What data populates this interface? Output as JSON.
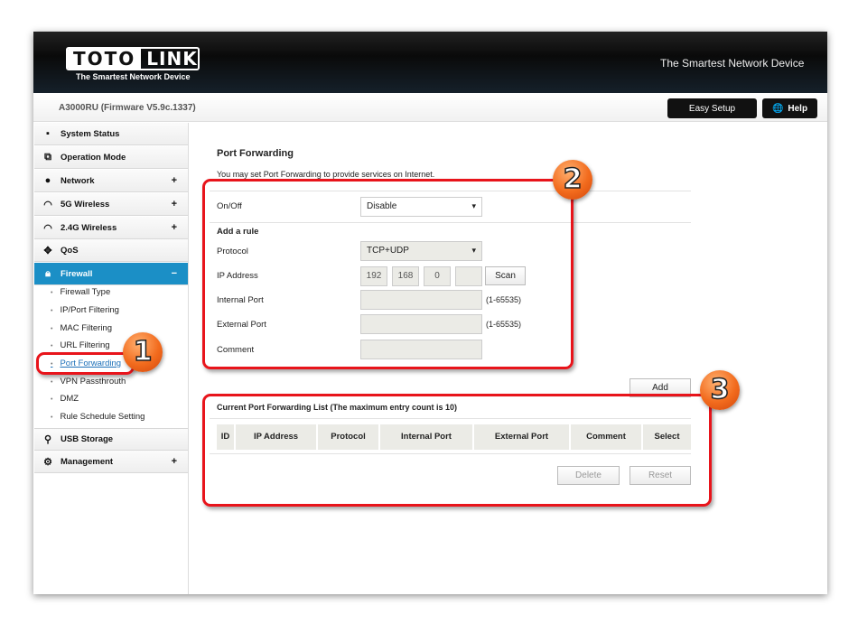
{
  "header": {
    "logo_left": "TOTO",
    "logo_right": "LINK",
    "logo_tagline": "The Smartest Network Device",
    "tagline": "The Smartest Network Device",
    "firmware": "A3000RU (Firmware V5.9c.1337)",
    "easy_setup": "Easy Setup",
    "help": "Help"
  },
  "sidebar": {
    "items": [
      {
        "label": "System Status",
        "icon": "chat-icon",
        "expand": ""
      },
      {
        "label": "Operation Mode",
        "icon": "windows-icon",
        "expand": ""
      },
      {
        "label": "Network",
        "icon": "globe-icon",
        "expand": "+"
      },
      {
        "label": "5G Wireless",
        "icon": "wifi-icon",
        "expand": "+"
      },
      {
        "label": "2.4G Wireless",
        "icon": "wifi-icon",
        "expand": "+"
      },
      {
        "label": "QoS",
        "icon": "arrows-icon",
        "expand": ""
      },
      {
        "label": "Firewall",
        "icon": "lock-icon",
        "expand": "−"
      },
      {
        "label": "USB Storage",
        "icon": "usb-icon",
        "expand": ""
      },
      {
        "label": "Management",
        "icon": "gear-icon",
        "expand": "+"
      }
    ],
    "firewall_sub": [
      "Firewall Type",
      "IP/Port Filtering",
      "MAC Filtering",
      "URL Filtering",
      "Port Forwarding",
      "VPN Passthrouth",
      "DMZ",
      "Rule Schedule Setting"
    ]
  },
  "main": {
    "title": "Port Forwarding",
    "description": "You may set Port Forwarding to provide services on Internet.",
    "onoff_label": "On/Off",
    "onoff_value": "Disable",
    "add_rule": "Add a rule",
    "protocol_label": "Protocol",
    "protocol_value": "TCP+UDP",
    "ip_label": "IP Address",
    "ip": [
      "192",
      "168",
      "0",
      ""
    ],
    "scan": "Scan",
    "internal_label": "Internal Port",
    "external_label": "External Port",
    "port_range": "(1-65535)",
    "comment_label": "Comment",
    "add": "Add",
    "list_title": "Current Port Forwarding List  (The maximum entry count is 10)",
    "columns": [
      "ID",
      "IP Address",
      "Protocol",
      "Internal Port",
      "External Port",
      "Comment",
      "Select"
    ],
    "delete": "Delete",
    "reset": "Reset"
  },
  "annotations": {
    "colors": {
      "highlight": "#e8141b",
      "badge": "#f26b1d"
    },
    "labels": [
      "1",
      "2",
      "3"
    ]
  }
}
